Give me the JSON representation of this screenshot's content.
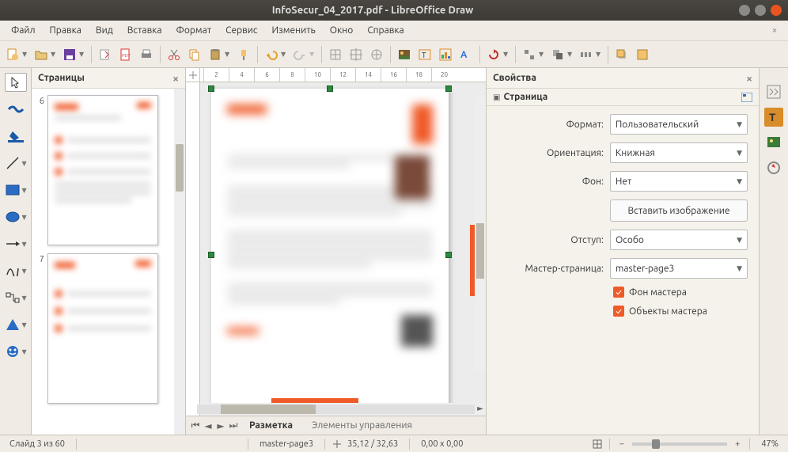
{
  "window": {
    "title": "InfoSecur_04_2017.pdf - LibreOffice Draw"
  },
  "menu": {
    "file": "Файл",
    "edit": "Правка",
    "view": "Вид",
    "insert": "Вставка",
    "format": "Формат",
    "tools": "Сервис",
    "modify": "Изменить",
    "window": "Окно",
    "help": "Справка"
  },
  "panels": {
    "pages_title": "Страницы",
    "properties_title": "Свойства",
    "section_page": "Страница"
  },
  "thumbs": {
    "a": "6",
    "b": "7"
  },
  "ruler": [
    "2",
    "4",
    "6",
    "8",
    "10",
    "12",
    "14",
    "16",
    "18",
    "20"
  ],
  "tabs": {
    "layout": "Разметка",
    "controls": "Элементы управления"
  },
  "props": {
    "format_label": "Формат:",
    "format_value": "Пользовательский",
    "orientation_label": "Ориентация:",
    "orientation_value": "Книжная",
    "background_label": "Фон:",
    "background_value": "Нет",
    "insert_image_btn": "Вставить изображение",
    "margin_label": "Отступ:",
    "margin_value": "Особо",
    "master_label": "Мастер-страница:",
    "master_value": "master-page3",
    "chk_master_bg": "Фон мастера",
    "chk_master_obj": "Объекты мастера"
  },
  "status": {
    "slide": "Слайд 3 из 60",
    "master": "master-page3",
    "coords": "35,12 / 32,63",
    "size": "0,00 x 0,00",
    "zoom": "47%"
  }
}
